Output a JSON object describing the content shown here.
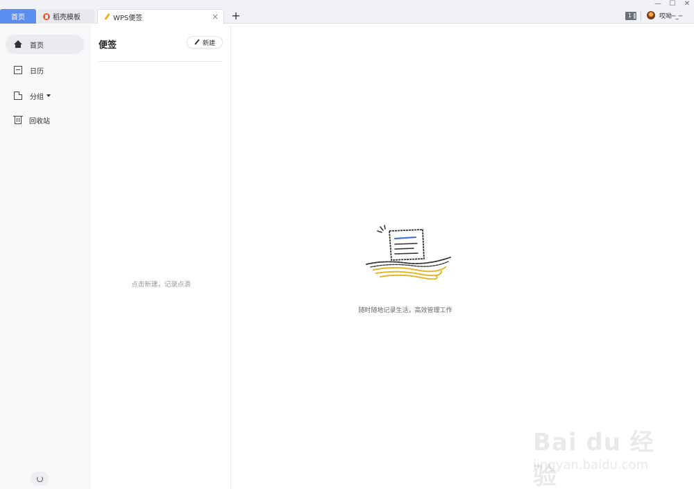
{
  "tabs": {
    "home": "首页",
    "daoke": "稻壳模板",
    "notes": "WPS便签",
    "close": "×",
    "add": "+"
  },
  "window": {
    "minimize": "—",
    "maximize": "☐",
    "close": "✕"
  },
  "toolbar": {
    "tab_count": "1",
    "username": "哎呦─_─"
  },
  "nav": {
    "items": [
      {
        "label": "首页",
        "icon": "house-icon",
        "active": true
      },
      {
        "label": "日历",
        "icon": "calendar-icon"
      },
      {
        "label": "分组",
        "icon": "folder-icon"
      },
      {
        "label": "回收站",
        "icon": "trash-icon"
      }
    ]
  },
  "list": {
    "title": "便签",
    "new_label": "新建",
    "empty_hint": "点击新建，记录点滴"
  },
  "main": {
    "hint": "随时随地记录生活，高效管理工作"
  },
  "colors": {
    "accent": "#5b8def",
    "illustration_blue": "#3f73d8",
    "illustration_yellow": "#e6b422"
  },
  "watermark": {
    "logo": "Bai du 经验",
    "url": "jingyan.baidu.com"
  }
}
